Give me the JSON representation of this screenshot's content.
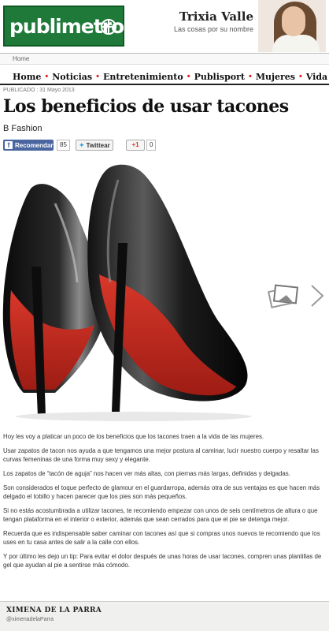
{
  "header": {
    "logo_text": "publimetro",
    "columnist_name": "Trixia Valle",
    "columnist_tagline": "Las cosas por su nombre"
  },
  "breadcrumb": "Home",
  "nav": {
    "items": [
      "Home",
      "Noticias",
      "Entretenimiento",
      "Publisport",
      "Mujeres",
      "Vida"
    ]
  },
  "article": {
    "published": "PUBLICADO : 31 Mayo 2013",
    "title": "Los beneficios de usar tacones",
    "byline": "B Fashion",
    "paragraphs": [
      "Hoy les voy a platicar un poco de los beneficios que los tacones traen a la vida de las mujeres.",
      "Usar zapatos de tacon nos ayuda a que tengamos una mejor postura al caminar, lucir nuestro cuerpo y resaltar las curvas femeninas de una forma muy sexy y elegante.",
      "Los zapatos de “tacón de aguja” nos hacen ver más altas, con piernas más largas, definidas y delgadas.",
      "Son considerados el toque perfecto de glamour en el guardarropa, además otra de sus ventajas es que hacen más delgado el tobillo y hacen parecer que los pies son más pequeños.",
      "Si no estás acostumbrada a utilizar tacones, te recomiendo empezar con unos de seis centímetros de altura o que tengan plataforma en el interior o exterior, además que sean cerrados para que el pie se detenga mejor.",
      "Recuerda que es indispensable saber caminar con tacones así que si compras unos nuevos te recomiendo que los uses en tu casa antes de salir a la calle con ellos.",
      "Y por último les dejo un tip: Para evitar el dolor después de unas horas de usar tacones, compren unas plantillas de gel que ayudan al pie a sentirse más cómodo."
    ]
  },
  "share": {
    "facebook_label": "Recomendar",
    "facebook_count": "85",
    "twitter_label": "Twittear",
    "gplus_label": "+1",
    "gplus_count": "0"
  },
  "author": {
    "name": "XIMENA DE LA PARRA",
    "handle": "@ximenadelaParra"
  },
  "colors": {
    "brand_green": "#1f7a3a",
    "nav_separator": "#e02020",
    "facebook_blue": "#4a66a0",
    "sole_red": "#c8281e"
  }
}
